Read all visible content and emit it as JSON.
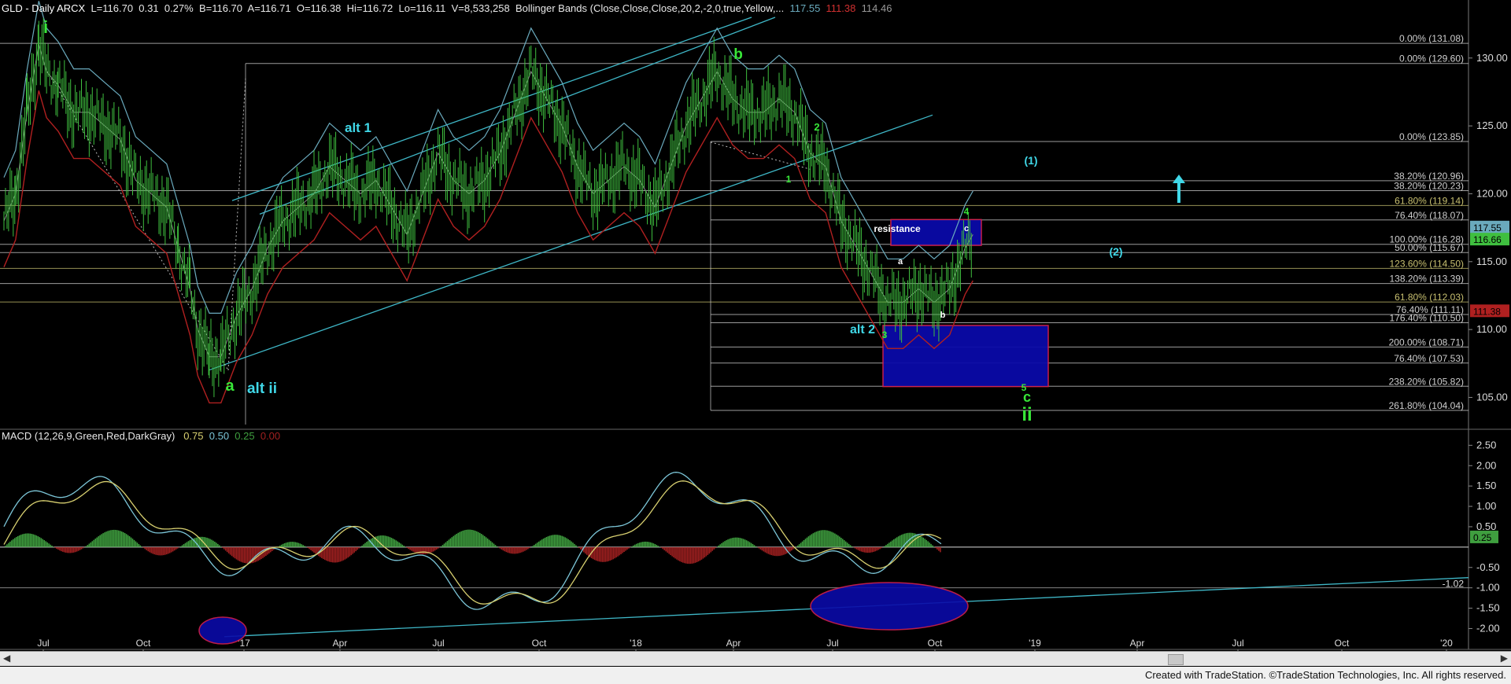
{
  "header": {
    "symbol": "GLD - Daily  ARCX",
    "last": "L=116.70",
    "chg": "0.31",
    "pct": "0.27%",
    "bid": "B=116.70",
    "ask": "A=116.71",
    "open": "O=116.38",
    "hi": "Hi=116.72",
    "lo": "Lo=116.11",
    "vol": "V=8,533,258",
    "study": "Bollinger Bands (Close,Close,Close,20,2,-2,0,true,Yellow,...",
    "bb_upper": "117.55",
    "bb_lower": "111.38",
    "bb_mid": "114.46"
  },
  "macd_header": {
    "label": "MACD (12,26,9,Green,Red,DarkGray)",
    "v1": "0.75",
    "v2": "0.50",
    "v3": "0.25",
    "v4": "0.00"
  },
  "footer": "Created with TradeStation. ©TradeStation Technologies, Inc. All rights reserved.",
  "colors": {
    "price": "#3fbf3f",
    "bb_upper": "#6aaabd",
    "bb_lower": "#b02020",
    "bb_mid": "#888888",
    "channel": "#3fb8c8",
    "fib": "#cfcfcf",
    "macd_pos": "#3f9f3f",
    "macd_neg": "#a02020",
    "macd_line": "#7cc6d8",
    "signal_line": "#d8d070",
    "label_green": "#38e838",
    "label_cyan": "#40d8e8",
    "box_blue": "#0a0aa8",
    "box_border": "#d02050"
  },
  "chart_data": [
    {
      "type": "line",
      "title": "GLD - Daily ARCX",
      "ylim": [
        103,
        133
      ],
      "y_ticks": [
        "130.00",
        "125.00",
        "120.00",
        "115.00",
        "110.00",
        "105.00"
      ],
      "x_ticks": [
        "Jul",
        "Oct",
        "'17",
        "Apr",
        "Jul",
        "Oct",
        "'18",
        "Apr",
        "Jul",
        "Oct",
        "'19",
        "Apr",
        "Jul",
        "Oct",
        "'20"
      ],
      "series": [
        {
          "values": [
            [
              0,
              118
            ],
            [
              15,
              120
            ],
            [
              30,
              126
            ],
            [
              45,
              131
            ],
            [
              55,
              129
            ],
            [
              70,
              128
            ],
            [
              90,
              126
            ],
            [
              110,
              126
            ],
            [
              130,
              125
            ],
            [
              150,
              124
            ],
            [
              170,
              121
            ],
            [
              190,
              120
            ],
            [
              210,
              119
            ],
            [
              225,
              116
            ],
            [
              240,
              113
            ],
            [
              250,
              110
            ],
            [
              265,
              108
            ],
            [
              280,
              108
            ],
            [
              300,
              111
            ],
            [
              320,
              113
            ],
            [
              340,
              116
            ],
            [
              360,
              118
            ],
            [
              380,
              119
            ],
            [
              400,
              120
            ],
            [
              420,
              122
            ],
            [
              440,
              121
            ],
            [
              460,
              120
            ],
            [
              480,
              121
            ],
            [
              500,
              119
            ],
            [
              520,
              117
            ],
            [
              540,
              120
            ],
            [
              560,
              123
            ],
            [
              580,
              121
            ],
            [
              600,
              120
            ],
            [
              620,
              121
            ],
            [
              640,
              123
            ],
            [
              660,
              126
            ],
            [
              680,
              129
            ],
            [
              700,
              127
            ],
            [
              720,
              125
            ],
            [
              740,
              122
            ],
            [
              760,
              120
            ],
            [
              780,
              121
            ],
            [
              800,
              122
            ],
            [
              820,
              121
            ],
            [
              840,
              119
            ],
            [
              860,
              122
            ],
            [
              880,
              125
            ],
            [
              900,
              127
            ],
            [
              920,
              129
            ],
            [
              940,
              127
            ],
            [
              960,
              126
            ],
            [
              980,
              126
            ],
            [
              1000,
              127
            ],
            [
              1020,
              126
            ],
            [
              1040,
              123
            ],
            [
              1060,
              122
            ],
            [
              1080,
              118
            ],
            [
              1100,
              116
            ],
            [
              1120,
              114
            ],
            [
              1140,
              112
            ],
            [
              1160,
              112
            ],
            [
              1180,
              113
            ],
            [
              1200,
              112
            ],
            [
              1220,
              113
            ],
            [
              1240,
              116
            ],
            [
              1250,
              117
            ]
          ]
        }
      ],
      "fib_levels": [
        {
          "label": "0.00% (131.08)",
          "value": 131.08
        },
        {
          "label": "0.00% (129.60)",
          "value": 129.6
        },
        {
          "label": "0.00% (123.85)",
          "value": 123.85
        },
        {
          "label": "38.20% (120.96)",
          "value": 120.96
        },
        {
          "label": "38.20% (120.23)",
          "value": 120.23
        },
        {
          "label": "61.80% (119.14)",
          "value": 119.14
        },
        {
          "label": "76.40% (118.07)",
          "value": 118.07
        },
        {
          "label": "100.00% (116.28)",
          "value": 116.28
        },
        {
          "label": "50.00% (115.67)",
          "value": 115.67
        },
        {
          "label": "123.60% (114.50)",
          "value": 114.5
        },
        {
          "label": "138.20% (113.39)",
          "value": 113.39
        },
        {
          "label": "61.80% (112.03)",
          "value": 112.03
        },
        {
          "label": "76.40% (111.11)",
          "value": 111.11
        },
        {
          "label": "176.40% (110.50)",
          "value": 110.5
        },
        {
          "label": "200.00% (108.71)",
          "value": 108.71
        },
        {
          "label": "76.40% (107.53)",
          "value": 107.53
        },
        {
          "label": "238.20% (105.82)",
          "value": 105.82
        },
        {
          "label": "261.80% (104.04)",
          "value": 104.04
        }
      ],
      "price_tags": [
        {
          "label": "117.55",
          "value": 117.55,
          "color": "#6aaabd"
        },
        {
          "label": "116.66",
          "value": 116.66,
          "color": "#3fbf3f"
        },
        {
          "label": "111.38",
          "value": 111.38,
          "color": "#b02020"
        }
      ],
      "annotations": [
        {
          "text": "i",
          "color": "green"
        },
        {
          "text": "a",
          "color": "green"
        },
        {
          "text": "alt ii",
          "color": "cyan"
        },
        {
          "text": "alt 1",
          "color": "cyan"
        },
        {
          "text": "b",
          "color": "green"
        },
        {
          "text": "1",
          "color": "green"
        },
        {
          "text": "2",
          "color": "green"
        },
        {
          "text": "3",
          "color": "green"
        },
        {
          "text": "4",
          "color": "green"
        },
        {
          "text": "5",
          "color": "green"
        },
        {
          "text": "c",
          "color": "green"
        },
        {
          "text": "ii",
          "color": "green"
        },
        {
          "text": "alt 2",
          "color": "cyan"
        },
        {
          "text": "(1)",
          "color": "cyan"
        },
        {
          "text": "(2)",
          "color": "cyan"
        },
        {
          "text": "resistance",
          "color": "white"
        },
        {
          "text": "a",
          "color": "white"
        },
        {
          "text": "b",
          "color": "white"
        },
        {
          "text": "c",
          "color": "white"
        }
      ]
    },
    {
      "type": "bar",
      "title": "MACD (12,26,9,Green,Red,DarkGray)",
      "ylim": [
        -2.3,
        2.7
      ],
      "y_ticks": [
        "2.50",
        "2.00",
        "1.50",
        "1.00",
        "0.50",
        "-0.50",
        "-1.00",
        "-1.50",
        "-2.00"
      ],
      "price_tags": [
        {
          "label": "0.25",
          "value": 0.25
        },
        {
          "label": "-1.02",
          "value": -1.02
        }
      ]
    }
  ]
}
